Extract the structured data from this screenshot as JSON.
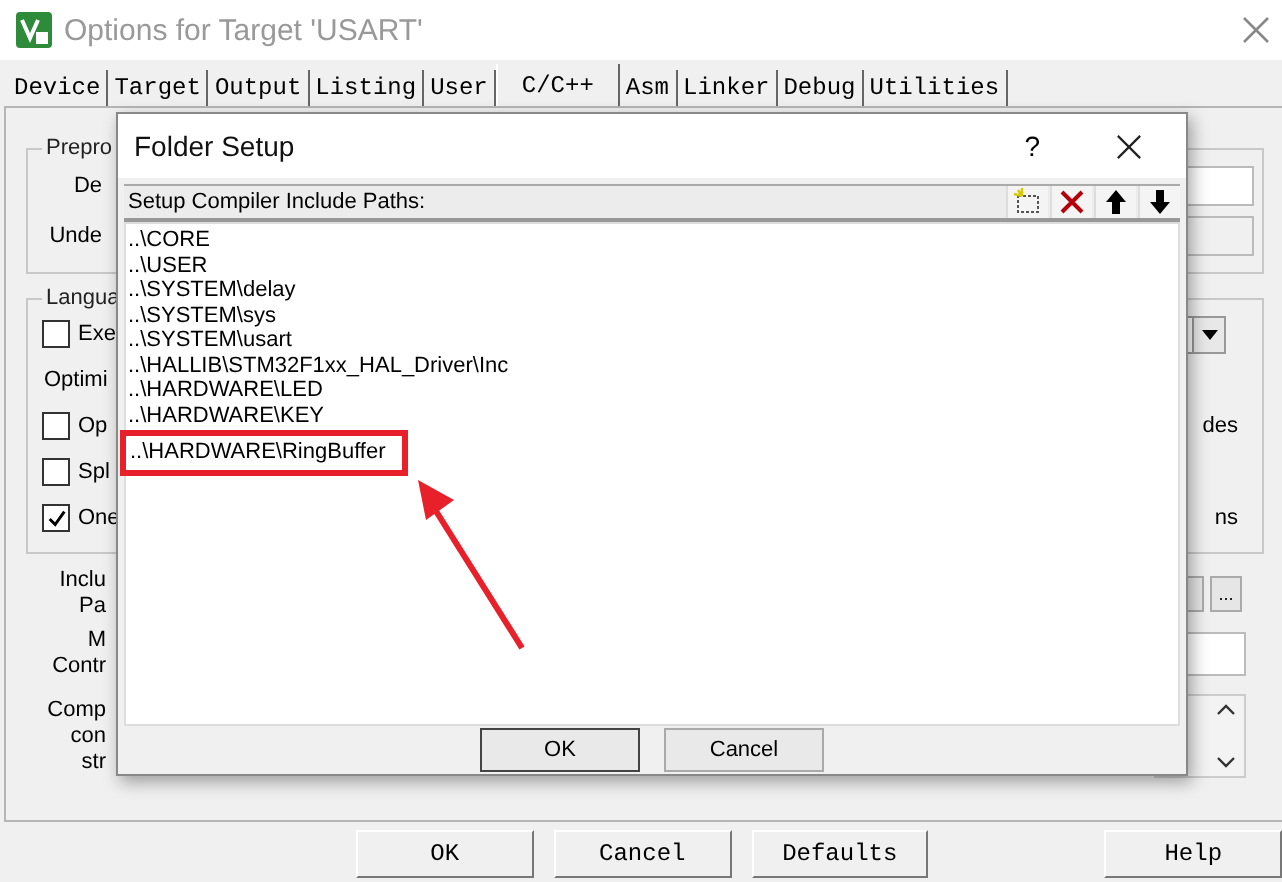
{
  "window": {
    "title": "Options for Target 'USART'"
  },
  "tabs": [
    {
      "label": "Device",
      "selected": false
    },
    {
      "label": "Target",
      "selected": false
    },
    {
      "label": "Output",
      "selected": false
    },
    {
      "label": "Listing",
      "selected": false
    },
    {
      "label": "User",
      "selected": false
    },
    {
      "label": "C/C++",
      "selected": true
    },
    {
      "label": "Asm",
      "selected": false
    },
    {
      "label": "Linker",
      "selected": false
    },
    {
      "label": "Debug",
      "selected": false
    },
    {
      "label": "Utilities",
      "selected": false
    }
  ],
  "groups": [
    {
      "title": "Prepro",
      "rows": [
        {
          "kind": "field",
          "label": "De",
          "disabled": false
        },
        {
          "kind": "field",
          "label": "Unde",
          "disabled": true
        }
      ]
    },
    {
      "title": "Langua",
      "rows": [
        {
          "kind": "checkbox",
          "label": "Exe",
          "checked": false,
          "right": {
            "kind": "dropdown"
          }
        },
        {
          "kind": "label",
          "label": "Optimi"
        },
        {
          "kind": "checkbox",
          "label": "Op",
          "checked": false,
          "right": {
            "kind": "text",
            "text": "des"
          }
        },
        {
          "kind": "checkbox",
          "label": "Spl",
          "checked": false
        },
        {
          "kind": "checkbox",
          "label": "One",
          "checked": true,
          "right": {
            "kind": "text",
            "text": "ns"
          }
        }
      ]
    }
  ],
  "lower_rows": [
    {
      "kind": "buttons",
      "label": [
        "Inclu",
        "Pa"
      ],
      "button": "..."
    },
    {
      "kind": "field",
      "label": [
        "M",
        "Contr"
      ]
    },
    {
      "kind": "textarea",
      "label": [
        "Comp",
        "con",
        "str"
      ]
    }
  ],
  "dialog": {
    "title": "Folder Setup",
    "help": "?",
    "list_label": "Setup Compiler Include Paths:",
    "paths": [
      {
        "text": "..\\CORE",
        "highlighted": false
      },
      {
        "text": "..\\USER",
        "highlighted": false
      },
      {
        "text": "..\\SYSTEM\\delay",
        "highlighted": false
      },
      {
        "text": "..\\SYSTEM\\sys",
        "highlighted": false
      },
      {
        "text": "..\\SYSTEM\\usart",
        "highlighted": false
      },
      {
        "text": "..\\HALLIB\\STM32F1xx_HAL_Driver\\Inc",
        "highlighted": false
      },
      {
        "text": "..\\HARDWARE\\LED",
        "highlighted": false
      },
      {
        "text": "..\\HARDWARE\\KEY",
        "highlighted": false
      },
      {
        "text": "..\\HARDWARE\\RingBuffer",
        "highlighted": true
      }
    ],
    "buttons": [
      "OK",
      "Cancel"
    ]
  },
  "footer_buttons": [
    "OK",
    "Cancel",
    "Defaults",
    "Help"
  ]
}
